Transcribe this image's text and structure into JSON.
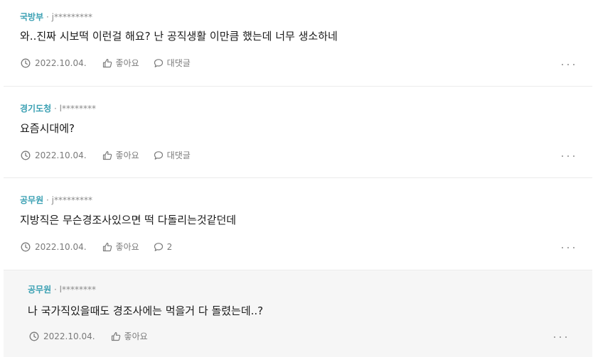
{
  "comments": [
    {
      "org": "국방부",
      "separator": "·",
      "user": "j*********",
      "text": "와..진짜 시보떡 이런걸 해요? 난 공직생활 이만큼 했는데 너무 생소하네",
      "date": "2022.10.04.",
      "like_label": "좋아요",
      "reply_label": "대댓글"
    },
    {
      "org": "경기도청",
      "separator": "·",
      "user": "l********",
      "text": "요즘시대에?",
      "date": "2022.10.04.",
      "like_label": "좋아요",
      "reply_label": "대댓글"
    },
    {
      "org": "공무원",
      "separator": "·",
      "user": "j*********",
      "text": "지방직은 무슨경조사있으면 떡 다돌리는것같던데",
      "date": "2022.10.04.",
      "like_label": "좋아요",
      "reply_label": "2"
    },
    {
      "org": "공무원",
      "separator": "·",
      "user": "l********",
      "text": "나 국가직있을때도 경조사에는 먹을거 다 돌렸는데..?",
      "date": "2022.10.04.",
      "like_label": "좋아요"
    }
  ],
  "icons": {
    "clock": "clock-icon",
    "like": "thumbs-up-icon",
    "reply": "speech-bubble-icon",
    "more": "more-horizontal-icon"
  },
  "colors": {
    "org": "#3aa0b3",
    "reply_bg": "#f6f6f6",
    "divider": "#ebebeb"
  }
}
